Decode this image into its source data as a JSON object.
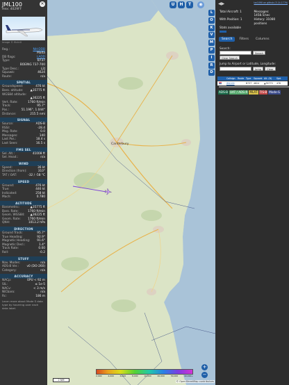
{
  "aircraft": {
    "callsign": "JML100",
    "hex_line": "Hex: 4029FF",
    "photo_credit": "Image © flickr0",
    "close_icon": "close-icon"
  },
  "info_rows": [
    {
      "k": "Reg.:",
      "v": "NH-DDB",
      "link": true
    },
    {
      "k": "",
      "v": "Malta"
    },
    {
      "k": "DB flags:",
      "v": "LADD",
      "link": true
    },
    {
      "k": "Type:",
      "v": "B737"
    },
    {
      "k": "",
      "v": "BOEING 737-700"
    },
    {
      "k": "Type Desc.:",
      "v": "L2J"
    },
    {
      "k": "Squawk:",
      "v": "4624"
    },
    {
      "k": "Route:",
      "v": "n/a"
    }
  ],
  "sections": [
    {
      "title": "SPATIAL",
      "rows": [
        {
          "k": "Groundspeed:",
          "v": "476 kt"
        },
        {
          "k": "Baro. altitude:",
          "v": "▲35775 ft"
        },
        {
          "k": "WGS84 altitude:",
          "v": ""
        },
        {
          "k": "",
          "v": "▲36225 ft"
        },
        {
          "k": "Vert. Rate:",
          "v": "1760 ft/min"
        },
        {
          "k": "Track:",
          "v": "95.7°"
        },
        {
          "k": "Pos.:",
          "v": "51.196°, 1.044°"
        },
        {
          "k": "Distance:",
          "v": "215.5 nmi"
        }
      ]
    },
    {
      "title": "SIGNAL",
      "rows": [
        {
          "k": "Source:",
          "v": "ADS-B"
        },
        {
          "k": "RSSI:",
          "v": "-28.4"
        },
        {
          "k": "Msg. Rate:",
          "v": "0.0"
        },
        {
          "k": "Messages:",
          "v": "140"
        },
        {
          "k": "Last Pos.:",
          "v": "18.4 s"
        },
        {
          "k": "Last Seen:",
          "v": "16.5 s"
        }
      ]
    },
    {
      "title": "FMS SEL",
      "rows": [
        {
          "k": "Sel. Alt.:",
          "v": "41008 ft"
        },
        {
          "k": "Sel. Head.:",
          "v": "n/a"
        }
      ]
    },
    {
      "title": "WIND",
      "rows": [
        {
          "k": "Speed:",
          "v": "36 kt"
        },
        {
          "k": "Direction (from):",
          "v": "310°"
        },
        {
          "k": "TAT / OAT:",
          "v": "-32 / -58 °C"
        }
      ]
    },
    {
      "title": "SPEED",
      "rows": [
        {
          "k": "Ground:",
          "v": "476 kt"
        },
        {
          "k": "True:",
          "v": "446 kt"
        },
        {
          "k": "Indicated:",
          "v": "258 kt"
        },
        {
          "k": "Mach:",
          "v": "0.780"
        }
      ]
    },
    {
      "title": "ALTITUDE",
      "rows": [
        {
          "k": "Barometric:",
          "v": "▲35775 ft"
        },
        {
          "k": "Baro. Rate:",
          "v": "1760 ft/min"
        },
        {
          "k": "Geom. WGS84:",
          "v": "▲36225 ft"
        },
        {
          "k": "Geom. Rate:",
          "v": "1760 ft/min"
        },
        {
          "k": "QNH:",
          "v": "1013.2 hPa"
        }
      ]
    },
    {
      "title": "DIRECTION",
      "rows": [
        {
          "k": "Ground Track:",
          "v": "95.7°"
        },
        {
          "k": "True Heading:",
          "v": "92.9°"
        },
        {
          "k": "Magnetic Heading:",
          "v": "91.6°"
        },
        {
          "k": "Magnetic Decl.:",
          "v": "1.4°"
        },
        {
          "k": "Track Rate:",
          "v": "0.00"
        },
        {
          "k": "Roll:",
          "v": "-0.2"
        }
      ]
    },
    {
      "title": "STUFF",
      "rows": [
        {
          "k": "Nav. Modes:",
          "v": "n/a"
        },
        {
          "k": "ADS-B Ver.:",
          "v": "v0 (DO-260)"
        },
        {
          "k": "Category:",
          "v": "n/a"
        }
      ]
    },
    {
      "title": "ACCURACY",
      "rows": [
        {
          "k": "NACp:",
          "v": "EPU < 92 m"
        },
        {
          "k": "SIL:",
          "v": "≤ 1e-5"
        },
        {
          "k": "NACv:",
          "v": "< 3 m/s"
        },
        {
          "k": "NICbaro:",
          "v": "n/a"
        },
        {
          "k": "Rc:",
          "v": "186 m"
        }
      ]
    }
  ],
  "footer_text": "Learn more about Mode S data type by hovering over each data label.",
  "map": {
    "buttons_top": [
      "U",
      "H",
      "T"
    ],
    "place_label": "Canterbury",
    "scale_label": "2 NM",
    "attribution": "© OpenStreetMap contributors",
    "zoom_in": "+",
    "zoom_out": "−",
    "legend_labels": [
      "2,000",
      "4,000",
      "6,000",
      "8,000",
      "10,000",
      "20,000",
      "30,000",
      "40,000+"
    ]
  },
  "sidebar_buttons": [
    "L",
    "O",
    "K",
    "V",
    "M",
    "P",
    "I",
    "R",
    "D"
  ],
  "right": {
    "link": "tar1090 on github (3.14.1776)",
    "stats": {
      "total_label": "Total Aircraft: 1",
      "messages_label": "Messages: 1458.5/sec",
      "position_label": "With Position: 1",
      "history_label": "History: 31080 positions",
      "stats_label": "Stats available"
    },
    "tabs": [
      "Search",
      "Filters",
      "Columns"
    ],
    "search_label": "Search:",
    "search_button": "Search",
    "clear_route_button": "Clear Search",
    "jump_label": "Jump to Airport or Latitude, Longitude:",
    "jump_button": "Jump",
    "clear_button": "Clear",
    "table_headers": [
      "Callsign",
      "Route",
      "Type",
      "Squawk",
      "Alt. (ft)",
      "Spd."
    ],
    "table_row": [
      "JML100",
      "",
      "B737",
      "4624",
      "▲35775",
      "476"
    ],
    "sources": [
      "ADS-B",
      "UAT / ADS-R",
      "MLAT",
      "TIS-B",
      "Mode-S"
    ]
  }
}
